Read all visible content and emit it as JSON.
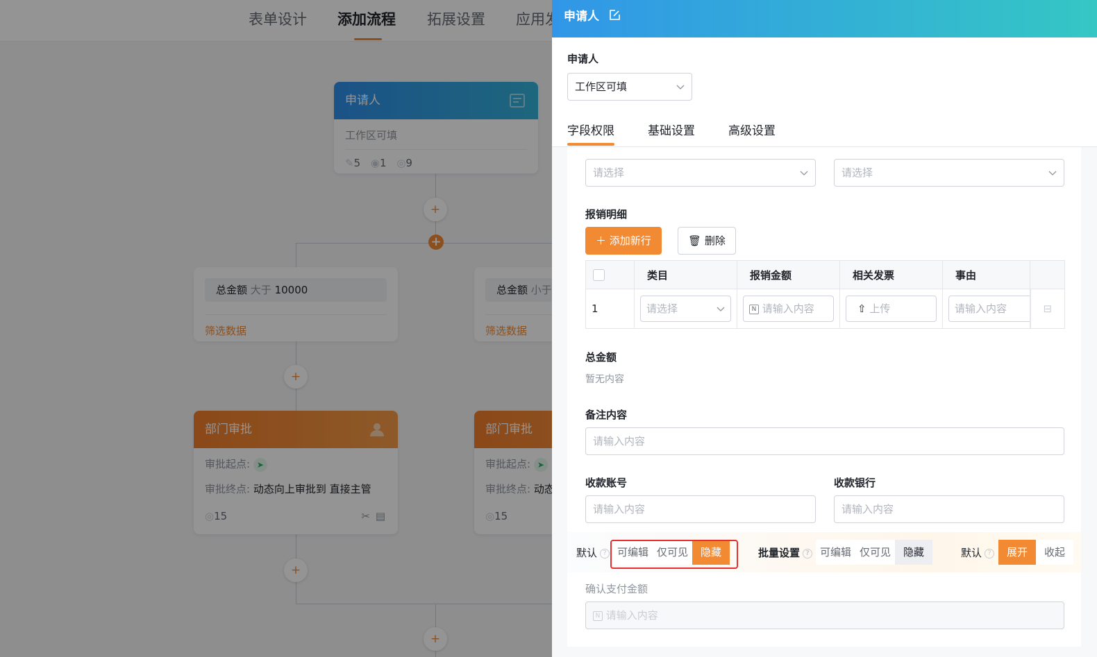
{
  "nav": {
    "tabs": [
      "表单设计",
      "添加流程",
      "拓展设置",
      "应用发"
    ],
    "active": "添加流程"
  },
  "canvas": {
    "applicant_node": {
      "title": "申请人",
      "subtitle": "工作区可填",
      "edit_count": "5",
      "view_count": "1",
      "hidden_count": "9"
    },
    "cond_left": {
      "field": "总金额",
      "op": "大于",
      "value": "10000",
      "filter": "筛选数据"
    },
    "cond_right": {
      "field": "总金额",
      "op": "小于",
      "filter": "筛选数据"
    },
    "approve_left": {
      "title": "部门审批",
      "start_label": "审批起点:",
      "end_label": "审批终点:",
      "end_value": "动态向上审批到 直接主管",
      "count": "15"
    },
    "approve_right": {
      "title": "部门审批",
      "start_label": "审批起点:",
      "end_label": "审批终点:",
      "end_value": "动态",
      "count": "15"
    }
  },
  "drawer": {
    "title": "申请人",
    "field_label": "申请人",
    "field_value": "工作区可填",
    "tabs": [
      "字段权限",
      "基础设置",
      "高级设置"
    ],
    "active_tab": "字段权限",
    "select_placeholder": "请选择",
    "detail": {
      "label": "报销明细",
      "add_btn": "添加新行",
      "delete_btn": "删除",
      "columns": [
        "类目",
        "报销金额",
        "相关发票",
        "事由"
      ],
      "row_index": "1",
      "cat_placeholder": "请选择",
      "amount_placeholder": "请输入内容",
      "upload_label": "上传",
      "reason_placeholder": "请输入内容"
    },
    "total_label": "总金额",
    "total_empty": "暂无内容",
    "remark_label": "备注内容",
    "remark_placeholder": "请输入内容",
    "account_label": "收款账号",
    "account_placeholder": "请输入内容",
    "bank_label": "收款银行",
    "bank_placeholder": "请输入内容",
    "perm": {
      "default_label": "默认",
      "options": [
        "可编辑",
        "仅可见",
        "隐藏"
      ],
      "batch_label": "批量设置",
      "batch_options": [
        "可编辑",
        "仅可见",
        "隐藏"
      ],
      "expand_label": "默认",
      "expand_options": [
        "展开",
        "收起"
      ]
    },
    "confirm_label": "确认支付金额",
    "confirm_placeholder": "请输入内容",
    "accent": "#f28a34"
  }
}
